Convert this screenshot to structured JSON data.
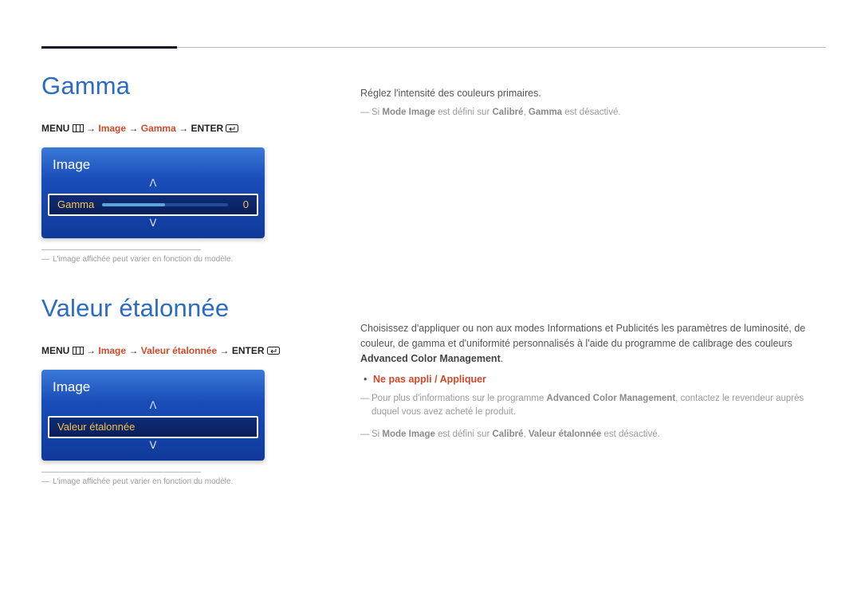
{
  "sections": {
    "gamma": {
      "title": "Gamma",
      "breadcrumb": {
        "menu": "MENU",
        "arrow": "→",
        "image": "Image",
        "item": "Gamma",
        "enter": "ENTER"
      },
      "osd": {
        "panel_title": "Image",
        "row_label": "Gamma",
        "row_value": "0"
      },
      "footnote": "L'image affichée peut varier en fonction du modèle.",
      "desc": "Réglez l'intensité des couleurs primaires.",
      "note_parts": {
        "p1": "Si ",
        "b1": "Mode Image",
        "p2": " est défini sur ",
        "b2": "Calibré",
        "p3": ", ",
        "b3": "Gamma",
        "p4": " est désactivé."
      }
    },
    "calibrated": {
      "title": "Valeur étalonnée",
      "breadcrumb": {
        "menu": "MENU",
        "arrow": "→",
        "image": "Image",
        "item": "Valeur étalonnée",
        "enter": "ENTER"
      },
      "osd": {
        "panel_title": "Image",
        "row_label": "Valeur étalonnée"
      },
      "footnote": "L'image affichée peut varier en fonction du modèle.",
      "desc_parts": {
        "p1": "Choisissez d'appliquer ou non aux modes Informations et Publicités les paramètres de luminosité, de couleur, de gamma et d'uniformité personnalisés à l'aide du programme de calibrage des couleurs ",
        "b1": "Advanced Color Management",
        "p2": "."
      },
      "options": "Ne pas appli / Appliquer",
      "note1_parts": {
        "p1": "Pour plus d'informations sur le programme ",
        "b1": "Advanced Color Management",
        "p2": ", contactez le revendeur auprès duquel vous avez acheté le produit."
      },
      "note2_parts": {
        "p1": "Si ",
        "b1": "Mode Image",
        "p2": " est défini sur ",
        "b2": "Calibré",
        "p3": ", ",
        "b3": "Valeur étalonnée",
        "p4": " est désactivé."
      }
    }
  },
  "icons": {
    "menu": "▥",
    "enter": "⏎",
    "up": "ᐱ",
    "down": "ᐯ"
  }
}
